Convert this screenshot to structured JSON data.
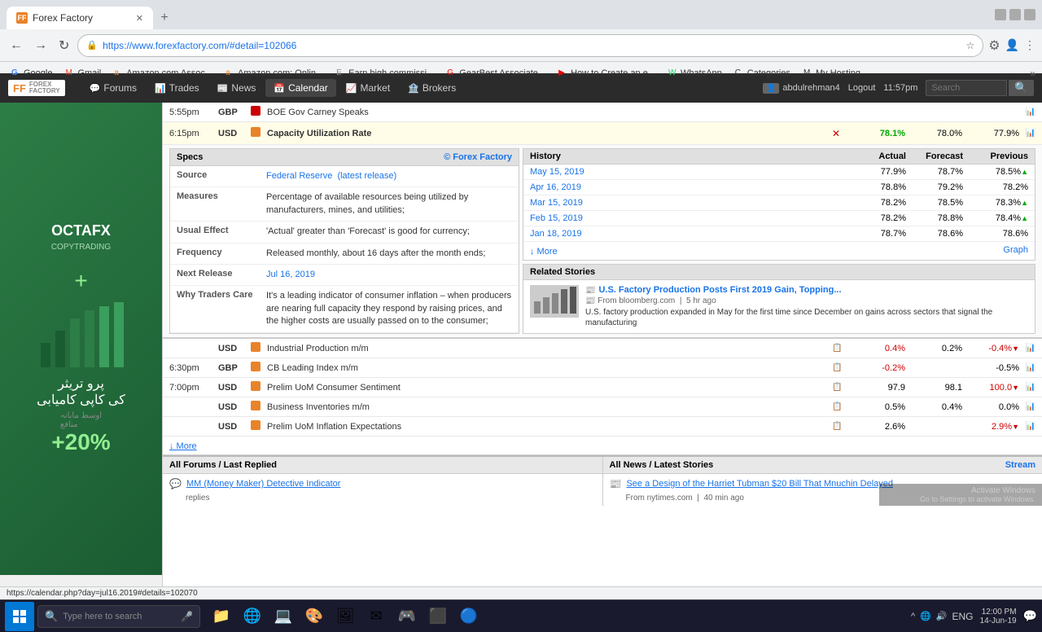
{
  "browser": {
    "tab_title": "Forex Factory",
    "tab_favicon": "FF",
    "url": "https://www.forexfactory.com/#detail=102066",
    "window_controls": {
      "minimize": "—",
      "maximize": "☐",
      "close": "✕"
    }
  },
  "bookmarks": [
    {
      "label": "Google",
      "icon": "G"
    },
    {
      "label": "Gmail",
      "icon": "M"
    },
    {
      "label": "Amazon.com Assoc...",
      "icon": "a"
    },
    {
      "label": "Amazon.com: Onlin...",
      "icon": "a"
    },
    {
      "label": "Earn high commissi...",
      "icon": "E"
    },
    {
      "label": "GearBest Associate...",
      "icon": "G"
    },
    {
      "label": "How to Create an e...",
      "icon": "▶"
    },
    {
      "label": "WhatsApp",
      "icon": "W"
    },
    {
      "label": "Categories",
      "icon": "C"
    },
    {
      "label": "My Hosting",
      "icon": "M"
    }
  ],
  "site": {
    "name": "FOREX FACTORY",
    "nav": [
      {
        "label": "Forums",
        "icon": "💬"
      },
      {
        "label": "Trades",
        "icon": "📊"
      },
      {
        "label": "News",
        "icon": "📰"
      },
      {
        "label": "Calendar",
        "icon": "📅"
      },
      {
        "label": "Market",
        "icon": "📈"
      },
      {
        "label": "Brokers",
        "icon": "🏦"
      }
    ],
    "user": "abdulrehman4",
    "logout": "Logout",
    "time": "11:57pm",
    "search_placeholder": "Search"
  },
  "calendar_rows": [
    {
      "time": "5:55pm",
      "currency": "GBP",
      "impact": "red",
      "event": "BOE Gov Carney Speaks",
      "actual": "",
      "forecast": "",
      "previous": ""
    },
    {
      "time": "6:15pm",
      "currency": "USD",
      "impact": "orange",
      "event": "Capacity Utilization Rate",
      "actual": "78.1%",
      "forecast": "78.0%",
      "previous": "77.9%"
    }
  ],
  "specs": {
    "header": "Specs",
    "ff_link": "© Forex Factory",
    "rows": [
      {
        "label": "Source",
        "value": "Federal Reserve",
        "link_text": "Federal Reserve",
        "link_href": "#",
        "extra": "(latest release)",
        "extra_href": "#"
      },
      {
        "label": "Measures",
        "value": "Percentage of available resources being utilized by manufacturers, mines, and utilities;"
      },
      {
        "label": "Usual Effect",
        "value": "'Actual' greater than 'Forecast' is good for currency;"
      },
      {
        "label": "Frequency",
        "value": "Released monthly, about 16 days after the month ends;"
      },
      {
        "label": "Next Release",
        "value": "Jul 16, 2019",
        "link_text": "Jul 16, 2019",
        "link_href": "#"
      },
      {
        "label": "Why Traders Care",
        "value": "It's a leading indicator of consumer inflation – when producers are nearing full capacity they respond by raising prices, and the higher costs are usually passed on to the consumer;"
      }
    ]
  },
  "history": {
    "header": "History",
    "cols": [
      "",
      "Actual",
      "Forecast",
      "Previous"
    ],
    "rows": [
      {
        "date": "May 15, 2019",
        "actual": "77.9%",
        "forecast": "78.7%",
        "previous": "78.5%",
        "arrow": "up"
      },
      {
        "date": "Apr 16, 2019",
        "actual": "78.8%",
        "forecast": "79.2%",
        "previous": "78.2%",
        "arrow": ""
      },
      {
        "date": "Mar 15, 2019",
        "actual": "78.2%",
        "forecast": "78.5%",
        "previous": "78.3%",
        "arrow": "up"
      },
      {
        "date": "Feb 15, 2019",
        "actual": "78.2%",
        "forecast": "78.8%",
        "previous": "78.4%",
        "arrow": "up"
      },
      {
        "date": "Jan 18, 2019",
        "actual": "78.7%",
        "forecast": "78.6%",
        "previous": "78.6%",
        "arrow": ""
      }
    ],
    "more": "↓ More",
    "graph": "Graph"
  },
  "related": {
    "header": "Related Stories",
    "story": {
      "title": "U.S. Factory Production Posts First 2019 Gain, Topping...",
      "source": "From bloomberg.com",
      "time": "5 hr ago",
      "description": "U.S. factory production expanded in May for the first time since December on gains across sectors that signal the manufacturing"
    }
  },
  "more_rows": [
    {
      "time": "",
      "currency": "USD",
      "impact": "orange",
      "event": "Industrial Production m/m",
      "actual": "0.4%",
      "forecast": "0.2%",
      "previous": "-0.4%",
      "prev_arrow": "down"
    },
    {
      "time": "6:30pm",
      "currency": "GBP",
      "impact": "orange",
      "event": "CB Leading Index m/m",
      "actual": "-0.2%",
      "forecast": "",
      "previous": "-0.5%"
    },
    {
      "time": "7:00pm",
      "currency": "USD",
      "impact": "orange",
      "event": "Prelim UoM Consumer Sentiment",
      "actual": "97.9",
      "forecast": "98.1",
      "previous": "100.0",
      "prev_arrow": "down"
    },
    {
      "time": "",
      "currency": "USD",
      "impact": "orange",
      "event": "Business Inventories m/m",
      "actual": "0.5%",
      "forecast": "0.4%",
      "previous": "0.0%"
    },
    {
      "time": "",
      "currency": "USD",
      "impact": "orange",
      "event": "Prelim UoM Inflation Expectations",
      "actual": "2.6%",
      "forecast": "",
      "previous": "2.9%",
      "prev_arrow": "down"
    }
  ],
  "more_button": "↓ More",
  "bottom": {
    "forums_header": "All Forums / Last Replied",
    "news_header": "All News / Latest Stories",
    "forum_item": {
      "title": "MM (Money Maker) Detective Indicator",
      "meta": "replies"
    },
    "news_item": {
      "title": "See a Design of the Harriet Tubman $20 Bill That Mnuchin Delayed",
      "source": "From nytimes.com",
      "time": "40 min ago"
    }
  },
  "taskbar": {
    "search_placeholder": "Type here to search",
    "time": "12:00 PM",
    "date": "14-Jun-19",
    "language": "ENG",
    "activate_text": "Activate Windows",
    "activate_sub": "Go to Settings to activate Windows.",
    "stream_btn": "Stream"
  },
  "status_bar": {
    "url": "https://calendar.php?day=jul16.2019#details=102070"
  }
}
